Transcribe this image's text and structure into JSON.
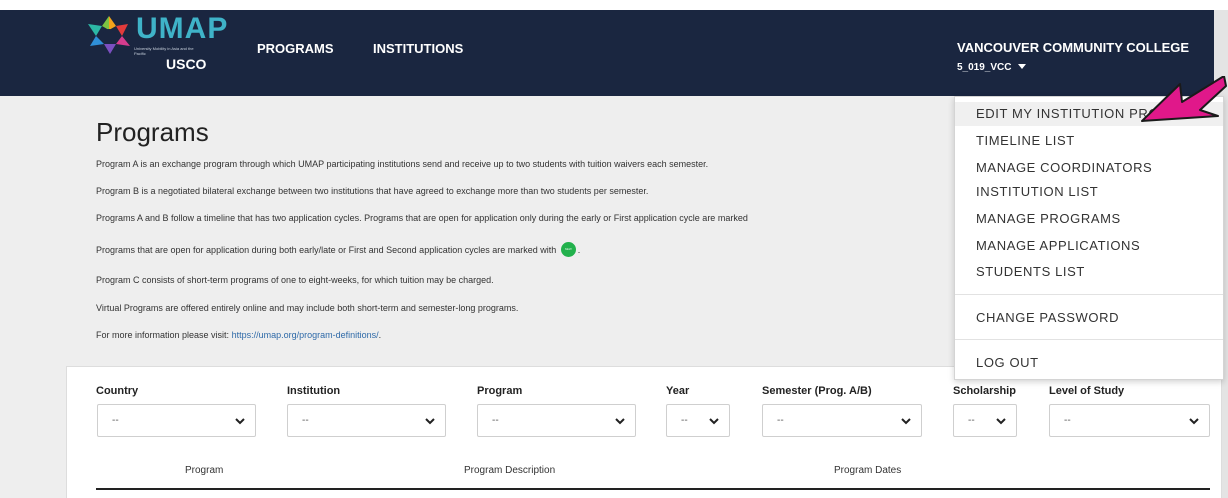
{
  "navbar": {
    "logo_text": "UMAP",
    "logo_tagline": "University Mobility in Asia and the Pacific",
    "logo_sub": "USCO",
    "links": [
      "PROGRAMS",
      "INSTITUTIONS"
    ],
    "institution_name": "VANCOUVER COMMUNITY COLLEGE",
    "institution_code": "5_019_VCC"
  },
  "page": {
    "title": "Programs",
    "paragraphs": [
      "Program A is an exchange program through which UMAP participating institutions send and receive up to two students with tuition waivers each semester.",
      "Program B is a negotiated bilateral exchange between two institutions that have agreed to exchange more than two students per semester.",
      "Programs A and B follow a timeline that has two application cycles. Programs that are open for application only during the early or First application cycle are marked",
      "Programs that are open for application during both early/late or First and Second application cycles are marked with",
      "Program C consists of short-term programs of one to eight-weeks, for which tuition may be charged.",
      "Virtual Programs are offered entirely online and may include both short-term and semester-long programs.",
      "For more information please visit:"
    ],
    "badge_text": "NEW",
    "info_link": "https://umap.org/program-definitions/",
    "info_link_suffix": "."
  },
  "filters": {
    "labels": [
      "Country",
      "Institution",
      "Program",
      "Year",
      "Semester (Prog. A/B)",
      "Scholarship",
      "Level of Study"
    ],
    "values": [
      "--",
      "--",
      "--",
      "--",
      "--",
      "--",
      "--"
    ]
  },
  "table": {
    "headers": [
      "Program",
      "Program Description",
      "Program Dates"
    ]
  },
  "menu": {
    "items": [
      "EDIT MY INSTITUTION PROFILE",
      "TIMELINE LIST",
      "MANAGE COORDINATORS",
      "INSTITUTION LIST",
      "MANAGE PROGRAMS",
      "MANAGE APPLICATIONS",
      "STUDENTS LIST"
    ],
    "change_password": "CHANGE PASSWORD",
    "logout": "LOG OUT"
  },
  "colors": {
    "navbar": "#1a2640",
    "arrow": "#e0188a",
    "badge": "#22b14c",
    "link": "#2f6aa8"
  },
  "icons": {
    "caret": "caret-down-icon",
    "select_chevron": "chevron-down-icon",
    "logo": "umap-logo-icon",
    "annotation": "pointer-arrow-icon"
  }
}
